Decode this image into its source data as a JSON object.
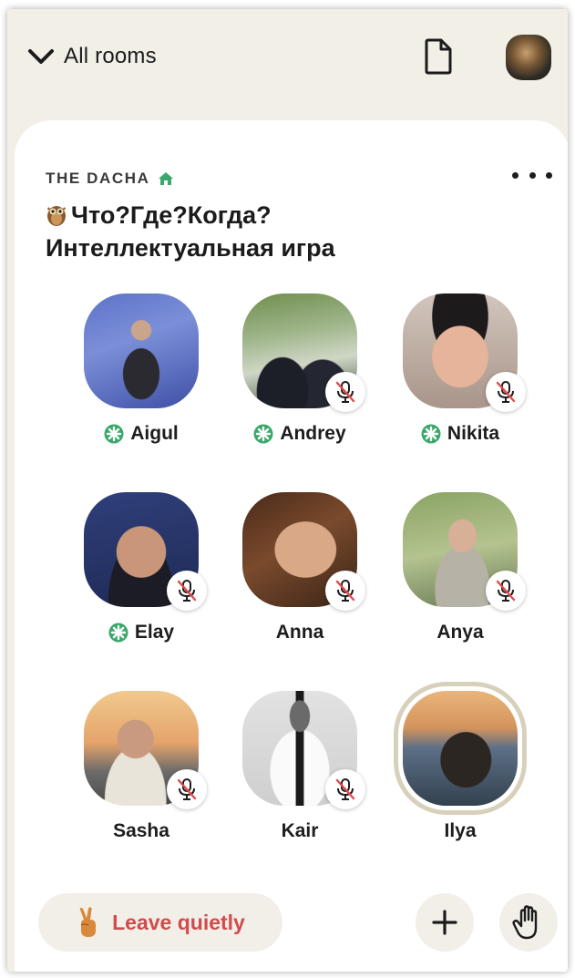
{
  "topbar": {
    "all_rooms_label": "All rooms"
  },
  "room": {
    "club_name": "THE DACHA",
    "title_line1": "Что?Где?Когда?",
    "title_line2": "Интеллектуальная игра"
  },
  "speakers": [
    {
      "name": "Aigul",
      "new_member": true,
      "muted": false,
      "speaking": false
    },
    {
      "name": "Andrey",
      "new_member": true,
      "muted": true,
      "speaking": false
    },
    {
      "name": "Nikita",
      "new_member": true,
      "muted": true,
      "speaking": false
    },
    {
      "name": "Elay",
      "new_member": true,
      "muted": true,
      "speaking": false
    },
    {
      "name": "Anna",
      "new_member": false,
      "muted": true,
      "speaking": false
    },
    {
      "name": "Anya",
      "new_member": false,
      "muted": true,
      "speaking": false
    },
    {
      "name": "Sasha",
      "new_member": false,
      "muted": true,
      "speaking": false
    },
    {
      "name": "Kair",
      "new_member": false,
      "muted": true,
      "speaking": false
    },
    {
      "name": "Ilya",
      "new_member": false,
      "muted": false,
      "speaking": true
    }
  ],
  "bottom": {
    "leave_label": "Leave quietly"
  },
  "colors": {
    "background": "#f2efe6",
    "card": "#ffffff",
    "leave_text": "#d24b4b",
    "new_member_badge": "#3aa86b",
    "club_house": "#3aa86b",
    "speaking_ring": "#d7d0bb"
  },
  "icons": {
    "dropdown": "chevron-down-icon",
    "document": "document-icon",
    "club": "house-icon",
    "more": "more-horizontal-icon",
    "muted": "mic-off-icon",
    "new_member": "new-member-icon",
    "leave": "peace-hand-icon",
    "add": "plus-icon",
    "raise_hand": "raise-hand-icon"
  }
}
